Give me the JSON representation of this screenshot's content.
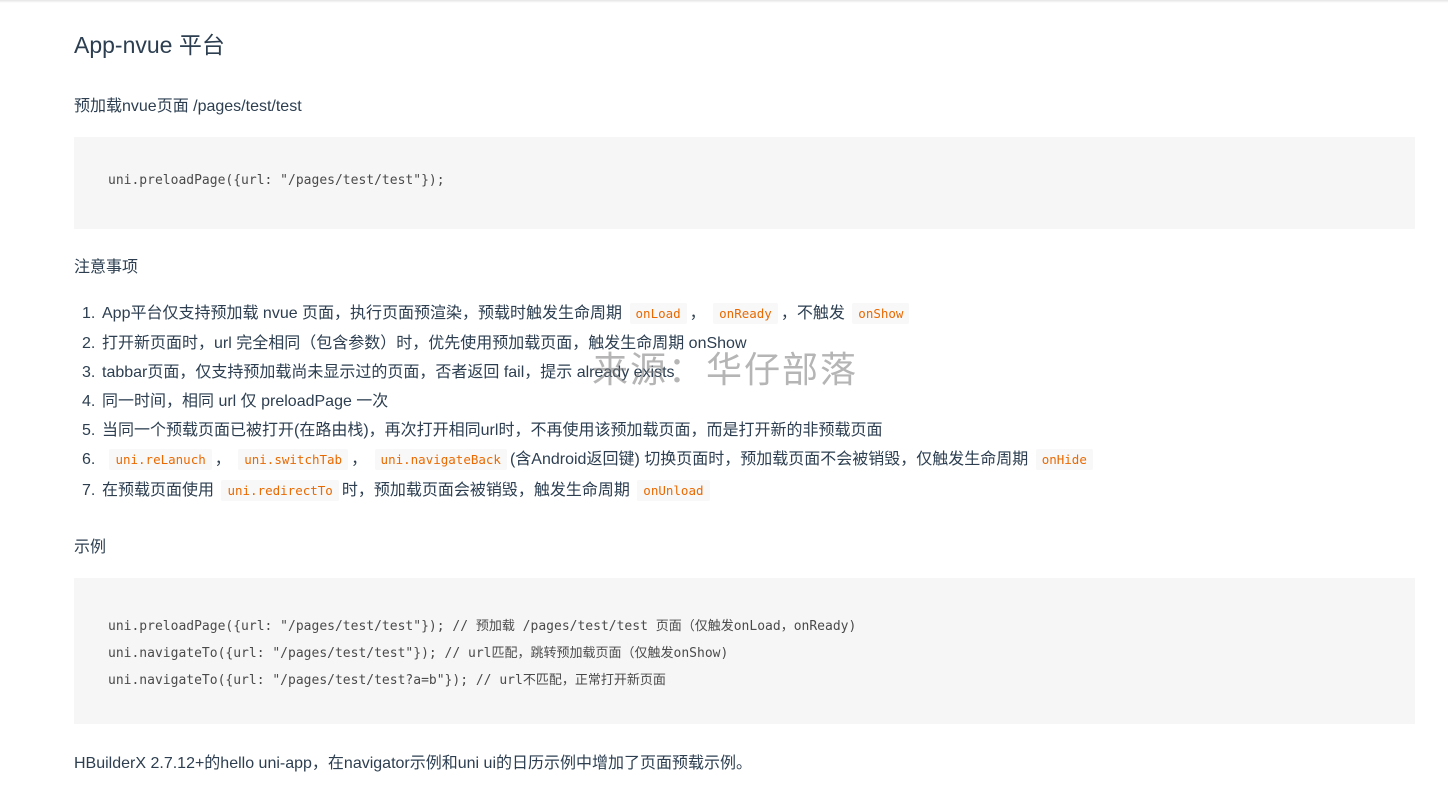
{
  "heading": "App-nvue 平台",
  "intro": "预加载nvue页面 /pages/test/test",
  "code1": "uni.preloadPage({url: \"/pages/test/test\"});",
  "notes_heading": "注意事项",
  "notes": {
    "n1": {
      "num": "1.",
      "text_a": "App平台仅支持预加载 nvue 页面，执行页面预渲染，预载时触发生命周期",
      "code_a": "onLoad",
      "sep1": "，",
      "code_b": "onReady",
      "text_b": "，不触发",
      "code_c": "onShow"
    },
    "n2": {
      "num": "2.",
      "text": "打开新页面时，url 完全相同（包含参数）时，优先使用预加载页面，触发生命周期 onShow"
    },
    "n3": {
      "num": "3.",
      "text": "tabbar页面，仅支持预加载尚未显示过的页面，否者返回 fail，提示 already exists"
    },
    "n4": {
      "num": "4.",
      "text": "同一时间，相同 url 仅 preloadPage 一次"
    },
    "n5": {
      "num": "5.",
      "text": "当同一个预载页面已被打开(在路由栈)，再次打开相同url时，不再使用该预加载页面，而是打开新的非预载页面"
    },
    "n6": {
      "num": "6.",
      "code_a": "uni.reLanuch",
      "sep1": "，",
      "code_b": "uni.switchTab",
      "sep2": "，",
      "code_c": "uni.navigateBack",
      "text_a": "(含Android返回键) 切换页面时，预加载页面不会被销毁，仅触发生命周期",
      "code_d": "onHide"
    },
    "n7": {
      "num": "7.",
      "text_a": "在预载页面使用",
      "code_a": "uni.redirectTo",
      "text_b": "时，预加载页面会被销毁，触发生命周期",
      "code_b": "onUnload"
    }
  },
  "example_heading": "示例",
  "code2": {
    "line1": "uni.preloadPage({url: \"/pages/test/test\"}); // 预加载 /pages/test/test 页面（仅触发onLoad，onReady)",
    "line2": "uni.navigateTo({url: \"/pages/test/test\"}); // url匹配，跳转预加载页面（仅触发onShow)",
    "line3": "uni.navigateTo({url: \"/pages/test/test?a=b\"}); // url不匹配，正常打开新页面"
  },
  "footer": "HBuilderX 2.7.12+的hello uni-app，在navigator示例和uni ui的日历示例中增加了页面预载示例。",
  "watermark": "来源：华仔部落"
}
